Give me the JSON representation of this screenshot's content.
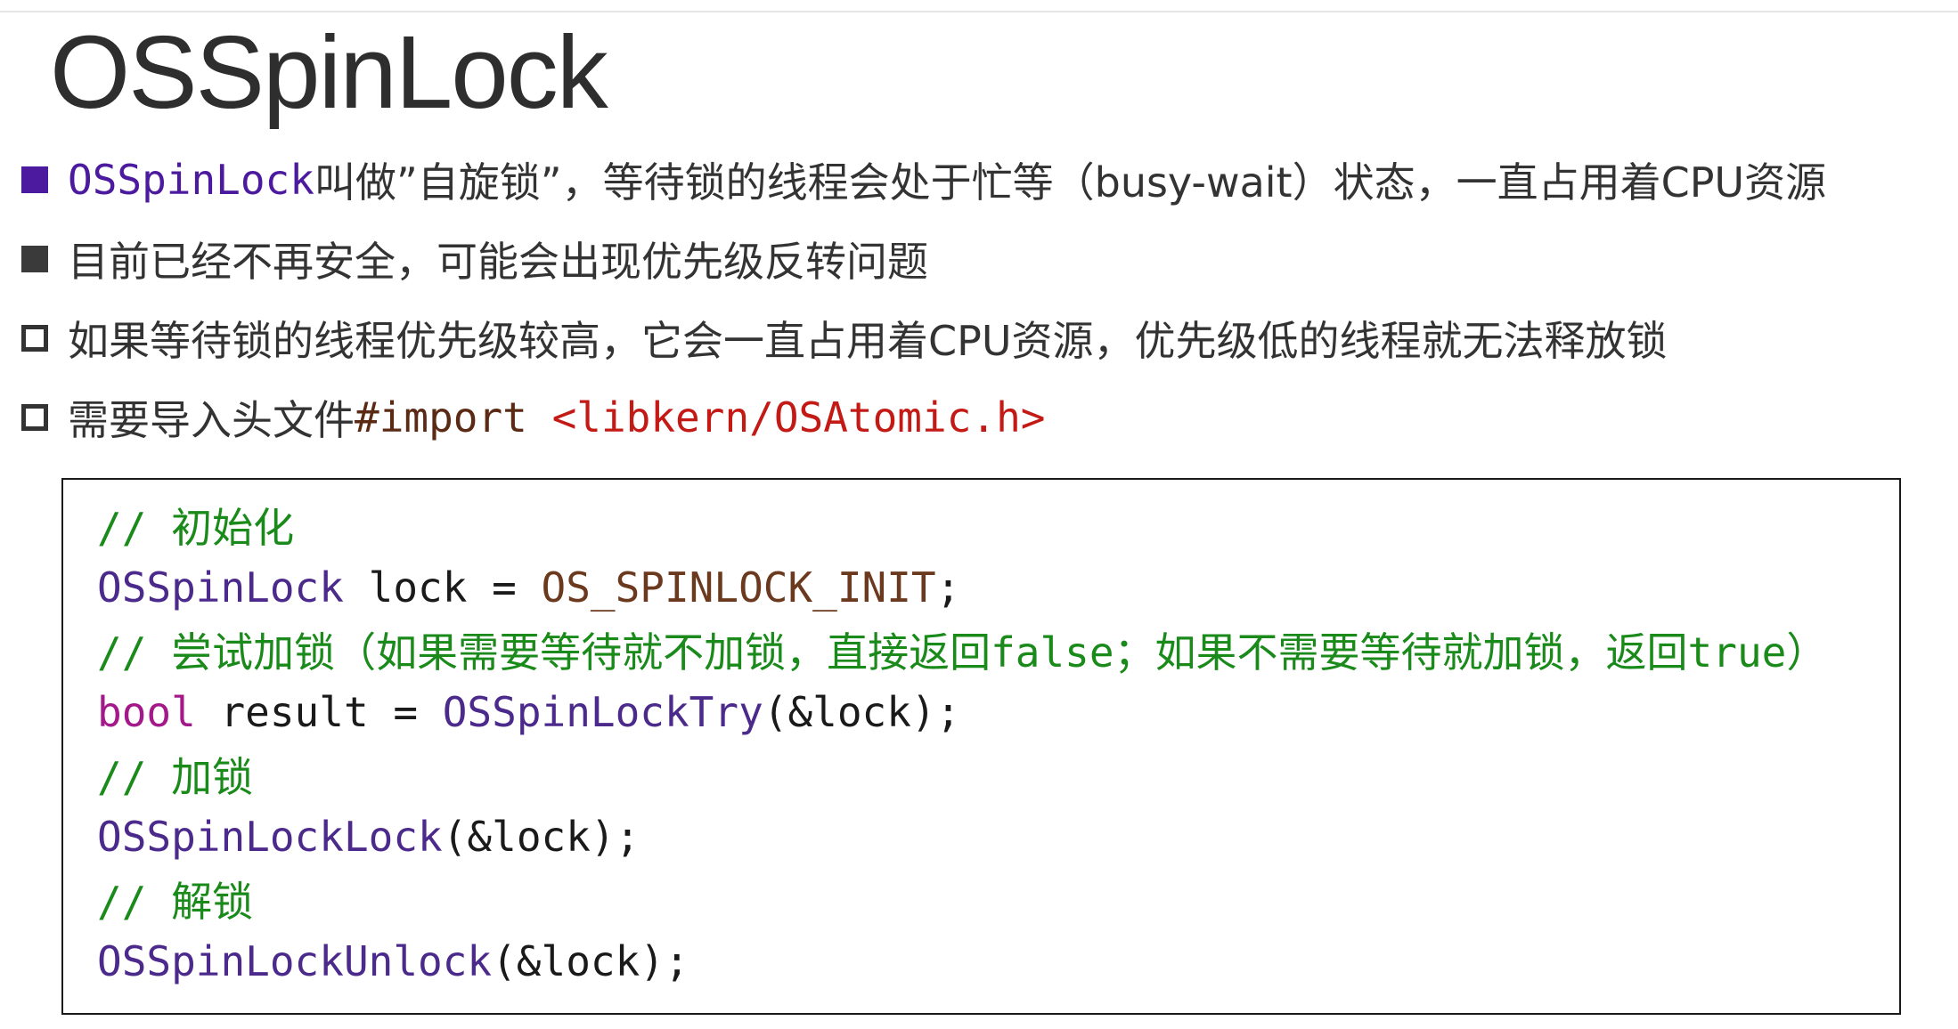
{
  "title": "OSSpinLock",
  "bullets": {
    "b1": {
      "lead": "OSSpinLock",
      "rest": "叫做”自旋锁”，等待锁的线程会处于忙等（busy-wait）状态，一直占用着CPU资源"
    },
    "b2": {
      "text": "目前已经不再安全，可能会出现优先级反转问题"
    },
    "b3": {
      "text": "如果等待锁的线程优先级较高，它会一直占用着CPU资源，优先级低的线程就无法释放锁"
    },
    "b4": {
      "lead": "需要导入头文件",
      "directive": "#import",
      "header": "<libkern/OSAtomic.h>"
    }
  },
  "code": {
    "line1": {
      "comment": "// 初始化"
    },
    "line2": {
      "type": "OSSpinLock",
      "mid": " lock = ",
      "macro": "OS_SPINLOCK_INIT",
      "end": ";"
    },
    "line3": {
      "comment": "// 尝试加锁（如果需要等待就不加锁，直接返回false；如果不需要等待就加锁，返回true）"
    },
    "line4": {
      "kw": "bool",
      "mid": " result = ",
      "fn": "OSSpinLockTry",
      "end": "(&lock);"
    },
    "line5": {
      "comment": "// 加锁"
    },
    "line6": {
      "fn": "OSSpinLockLock",
      "end": "(&lock);"
    },
    "line7": {
      "comment": "// 解锁"
    },
    "line8": {
      "fn": "OSSpinLockUnlock",
      "end": "(&lock);"
    }
  },
  "colors": {
    "bullet_primary": "#4b1a9e",
    "comment": "#1a8a1a",
    "keyword": "#a3198a",
    "type": "#4b2a8c",
    "string_header": "#c41a16"
  },
  "icons": {
    "b1": "filled-square-bullet",
    "b2": "filled-square-bullet",
    "b3": "hollow-square-bullet",
    "b4": "hollow-square-bullet"
  }
}
